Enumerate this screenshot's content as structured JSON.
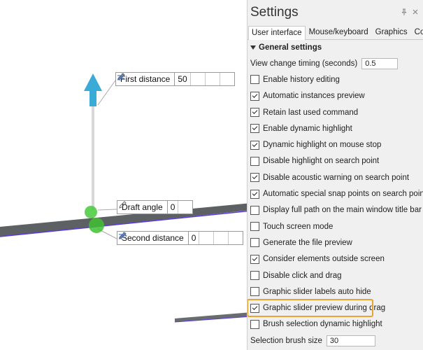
{
  "viewport": {
    "labels": {
      "first_distance": {
        "name": "First distance",
        "value": "50"
      },
      "draft_angle": {
        "name": "Draft angle",
        "value": "0"
      },
      "second_distance": {
        "name": "Second distance",
        "value": "0"
      }
    },
    "colors": {
      "arrow": "#3aaad6",
      "handle": "#46c93a",
      "surface": "#5e6163",
      "edge": "#5b3be0"
    }
  },
  "panel": {
    "title": "Settings",
    "tabs": [
      {
        "label": "User interface",
        "active": true
      },
      {
        "label": "Mouse/keyboard",
        "active": false
      },
      {
        "label": "Graphics",
        "active": false
      },
      {
        "label": "Colours",
        "active": false
      }
    ],
    "section_title": "General settings",
    "view_change_timing": {
      "label": "View change timing (seconds)",
      "value": "0.5"
    },
    "options": [
      {
        "label": "Enable history editing",
        "checked": false
      },
      {
        "label": "Automatic instances preview",
        "checked": true
      },
      {
        "label": "Retain last used command",
        "checked": true
      },
      {
        "label": "Enable dynamic highlight",
        "checked": true
      },
      {
        "label": "Dynamic highlight on mouse stop",
        "checked": true
      },
      {
        "label": "Disable highlight on search point",
        "checked": false
      },
      {
        "label": "Disable acoustic warning on search point",
        "checked": true
      },
      {
        "label": "Automatic special snap points on search point",
        "checked": true
      },
      {
        "label": "Display full path on the main window title bar",
        "checked": false
      },
      {
        "label": "Touch screen mode",
        "checked": false
      },
      {
        "label": "Generate the file preview",
        "checked": false
      },
      {
        "label": "Consider elements outside screen",
        "checked": true
      },
      {
        "label": "Disable click and drag",
        "checked": false
      },
      {
        "label": "Graphic slider labels auto hide",
        "checked": false
      },
      {
        "label": "Graphic slider preview during drag",
        "checked": true,
        "highlighted": true
      },
      {
        "label": "Brush selection dynamic highlight",
        "checked": false
      }
    ],
    "selection_brush_size": {
      "label": "Selection brush size",
      "value": "30"
    },
    "highlight_color": "#e8a432"
  }
}
